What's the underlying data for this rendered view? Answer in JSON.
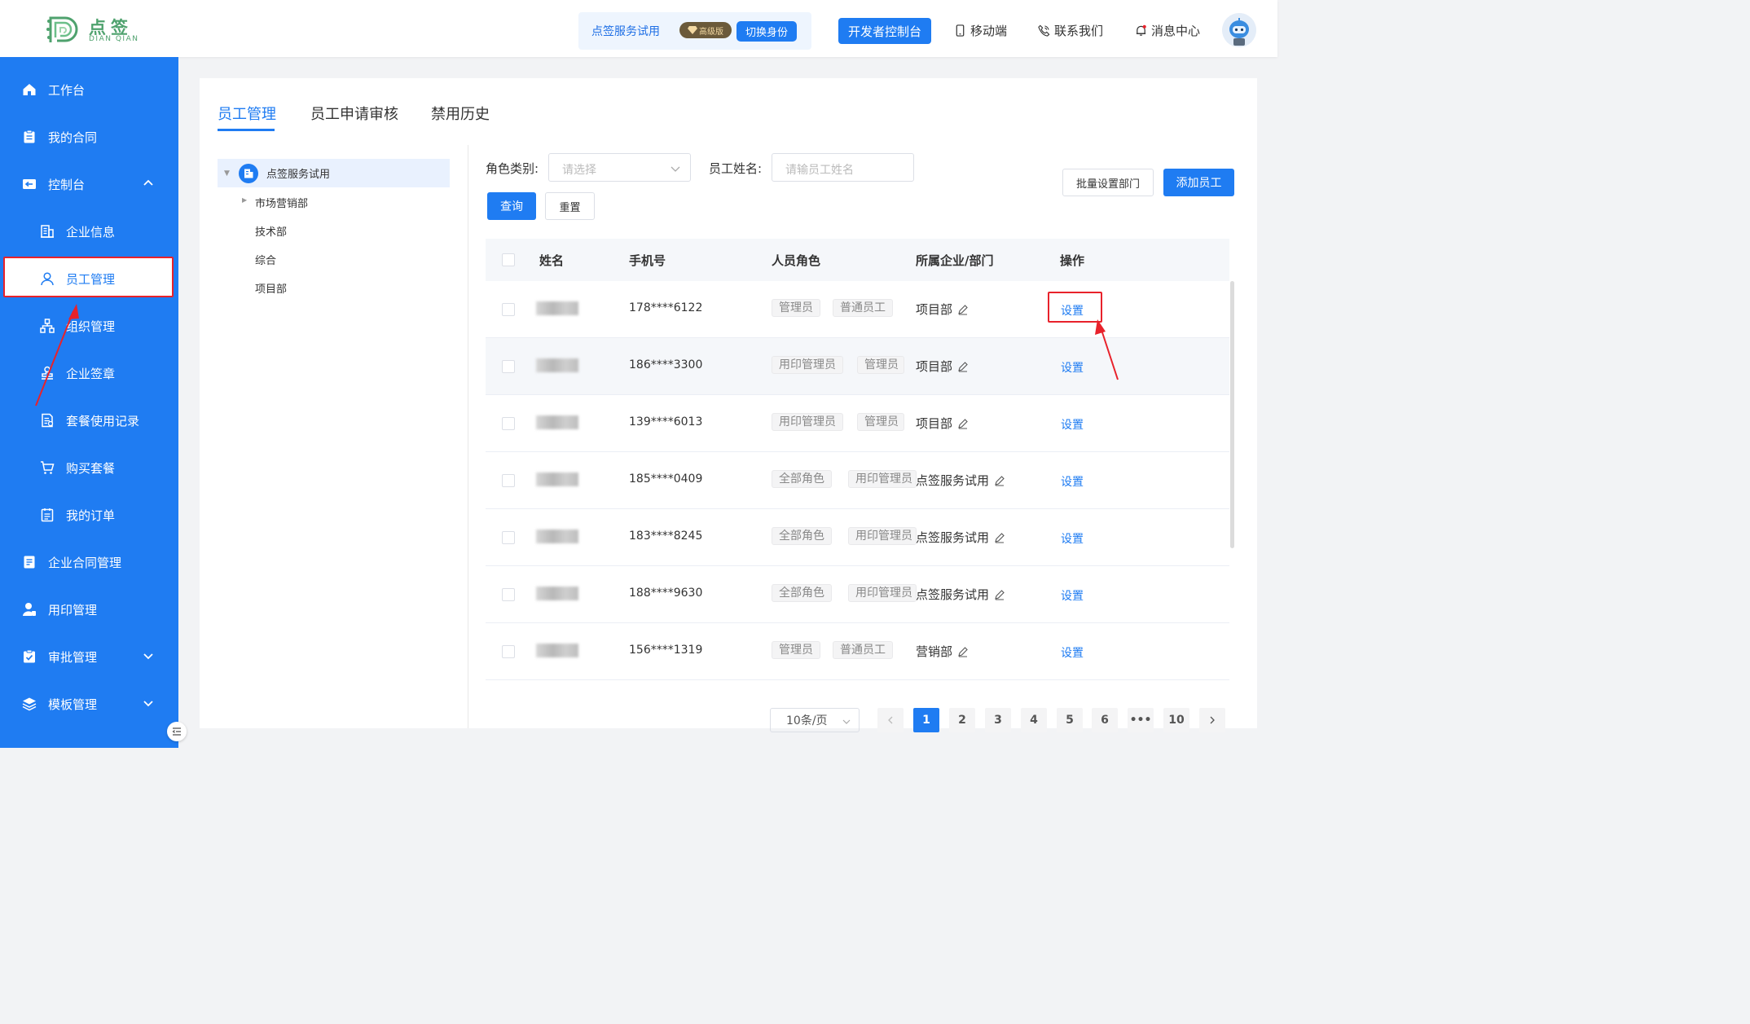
{
  "header": {
    "logo_cn": "点签",
    "logo_en": "DIAN QIAN",
    "account_name": "点签服务试用",
    "vip_label": "高级版",
    "switch_label": "切换身份",
    "dev_console_label": "开发者控制台",
    "mobile_label": "移动端",
    "contact_label": "联系我们",
    "message_label": "消息中心"
  },
  "sidebar": {
    "items": [
      {
        "label": "工作台",
        "icon": "home-icon"
      },
      {
        "label": "我的合同",
        "icon": "clipboard-icon"
      },
      {
        "label": "控制台",
        "icon": "console-icon"
      },
      {
        "label": "企业信息",
        "icon": "building-icon"
      },
      {
        "label": "员工管理",
        "icon": "user-icon"
      },
      {
        "label": "组织管理",
        "icon": "org-chart-icon"
      },
      {
        "label": "企业签章",
        "icon": "stamp-icon"
      },
      {
        "label": "套餐使用记录",
        "icon": "record-icon"
      },
      {
        "label": "购买套餐",
        "icon": "cart-icon"
      },
      {
        "label": "我的订单",
        "icon": "order-icon"
      },
      {
        "label": "企业合同管理",
        "icon": "contract-icon"
      },
      {
        "label": "用印管理",
        "icon": "seal-user-icon"
      },
      {
        "label": "审批管理",
        "icon": "approval-icon"
      },
      {
        "label": "模板管理",
        "icon": "layers-icon"
      }
    ]
  },
  "tabs": [
    "员工管理",
    "员工申请审核",
    "禁用历史"
  ],
  "tree": {
    "root": "点签服务试用",
    "children": [
      "市场营销部",
      "技术部",
      "综合",
      "项目部"
    ]
  },
  "filter": {
    "role_label": "角色类别:",
    "role_placeholder": "请选择",
    "name_label": "员工姓名:",
    "name_placeholder": "请输员工姓名",
    "query_label": "查询",
    "reset_label": "重置",
    "batch_label": "批量设置部门",
    "add_label": "添加员工"
  },
  "table": {
    "columns": [
      "姓名",
      "手机号",
      "人员角色",
      "所属企业/部门",
      "操作"
    ],
    "rows": [
      {
        "phone": "178****6122",
        "roles": [
          "管理员",
          "普通员工"
        ],
        "dept": "项目部",
        "action": "设置"
      },
      {
        "phone": "186****3300",
        "roles": [
          "用印管理员",
          "管理员"
        ],
        "dept": "项目部",
        "action": "设置"
      },
      {
        "phone": "139****6013",
        "roles": [
          "用印管理员",
          "管理员"
        ],
        "dept": "项目部",
        "action": "设置"
      },
      {
        "phone": "185****0409",
        "roles": [
          "全部角色",
          "用印管理员"
        ],
        "dept": "点签服务试用",
        "action": "设置"
      },
      {
        "phone": "183****8245",
        "roles": [
          "全部角色",
          "用印管理员"
        ],
        "dept": "点签服务试用",
        "action": "设置"
      },
      {
        "phone": "188****9630",
        "roles": [
          "全部角色",
          "用印管理员"
        ],
        "dept": "点签服务试用",
        "action": "设置"
      },
      {
        "phone": "156****1319",
        "roles": [
          "管理员",
          "普通员工"
        ],
        "dept": "营销部",
        "action": "设置"
      }
    ]
  },
  "pagination": {
    "page_size": "10条/页",
    "pages": [
      "1",
      "2",
      "3",
      "4",
      "5",
      "6",
      "•••",
      "10"
    ],
    "current": "1"
  },
  "colors": {
    "primary": "#1f7cf2",
    "highlight_red": "#e8222b",
    "logo_green": "#4fa26e"
  }
}
